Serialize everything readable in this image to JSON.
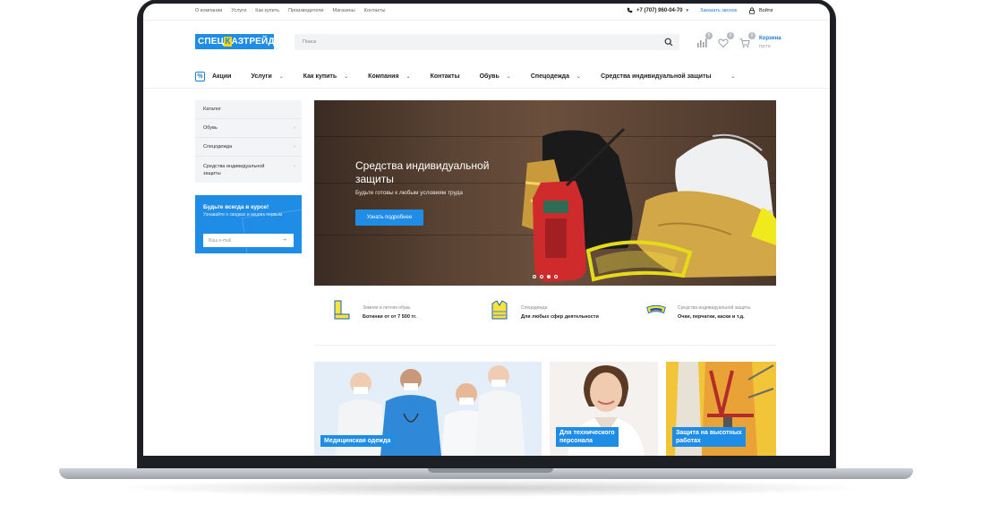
{
  "topbar": {
    "links": [
      "О компании",
      "Услуги",
      "Как купить",
      "Производители",
      "Магазины",
      "Контакты"
    ],
    "phone": "+7 (707) 960-04-70",
    "callback": "Заказать звонок",
    "login": "Войти"
  },
  "header": {
    "logo_part1": "СПЕЦ",
    "logo_highlight": "К",
    "logo_part2": "АЗТРЕЙД",
    "search_placeholder": "Поиск",
    "compare_count": "0",
    "favorites_count": "0",
    "cart_count": "0",
    "cart_title": "Корзина",
    "cart_status": "пуста"
  },
  "menu": {
    "items": [
      "Акции",
      "Услуги",
      "Как купить",
      "Компания",
      "Контакты",
      "Обувь",
      "Спецодежда",
      "Средства индивидуальной защиты"
    ]
  },
  "sidebar": {
    "items": [
      "Каталог",
      "Обувь",
      "Спецодежда",
      "Средства индивидуальной защиты"
    ],
    "subscribe_title": "Будьте всегда в курсе!",
    "subscribe_text": "Узнавайте о скидках и акциях первым",
    "email_placeholder": "Ваш e-mail"
  },
  "banner": {
    "title": "Средства индивидуальной защиты",
    "subtitle": "Будьте готовы к любым условиям труда",
    "button": "Узнать подробнее",
    "slides": 4,
    "active_slide": 3
  },
  "features": [
    {
      "small": "Зимняя и летняя обувь",
      "big": "Ботинки от  от 7 500 тг."
    },
    {
      "small": "Спецодежда",
      "big": "Для любых сфер деятельности"
    },
    {
      "small": "Средства индивидуальной защиты",
      "big": "Очки, перчатки, каски и т.д."
    }
  ],
  "tiles": [
    {
      "label": "Медицинская одежда"
    },
    {
      "label_line1": "Для технического",
      "label_line2": "персонала"
    },
    {
      "label_line1": "Защита на высотных",
      "label_line2": "работах"
    }
  ],
  "colors": {
    "accent": "#1f8ce6",
    "logo_yellow": "#ffd600",
    "frame": "#1c1f24"
  }
}
